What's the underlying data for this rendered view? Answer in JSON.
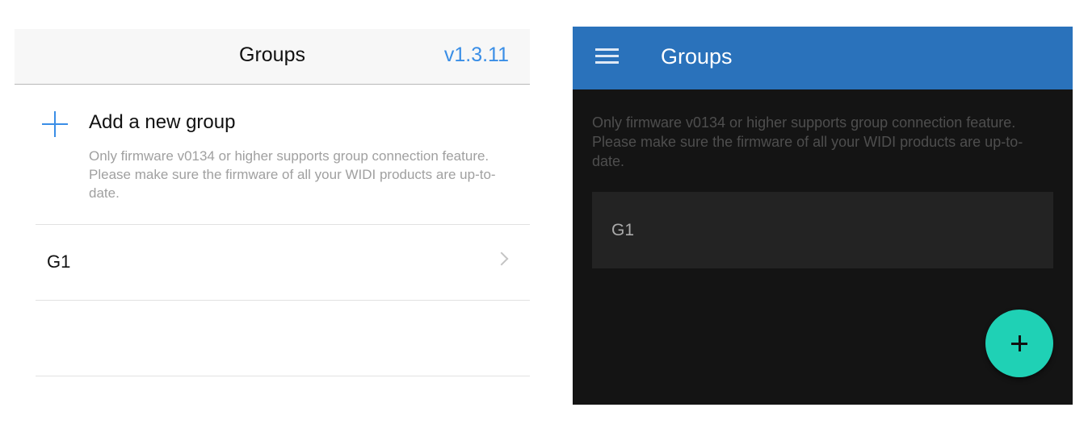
{
  "ios": {
    "header": {
      "title": "Groups",
      "version": "v1.3.11"
    },
    "add_group_label": "Add a new group",
    "description": "Only firmware v0134 or higher supports group connection feature. Please make sure the firmware of all your WIDI products are up-to-date.",
    "groups": [
      {
        "name": "G1"
      }
    ]
  },
  "android": {
    "header": {
      "title": "Groups"
    },
    "description": "Only firmware v0134 or higher supports group connection feature. Please make sure the firmware of all your WIDI products are up-to-date.",
    "groups": [
      {
        "name": "G1"
      }
    ],
    "colors": {
      "header": "#2a72bb",
      "fab": "#1fd1b5",
      "background": "#141414"
    }
  }
}
